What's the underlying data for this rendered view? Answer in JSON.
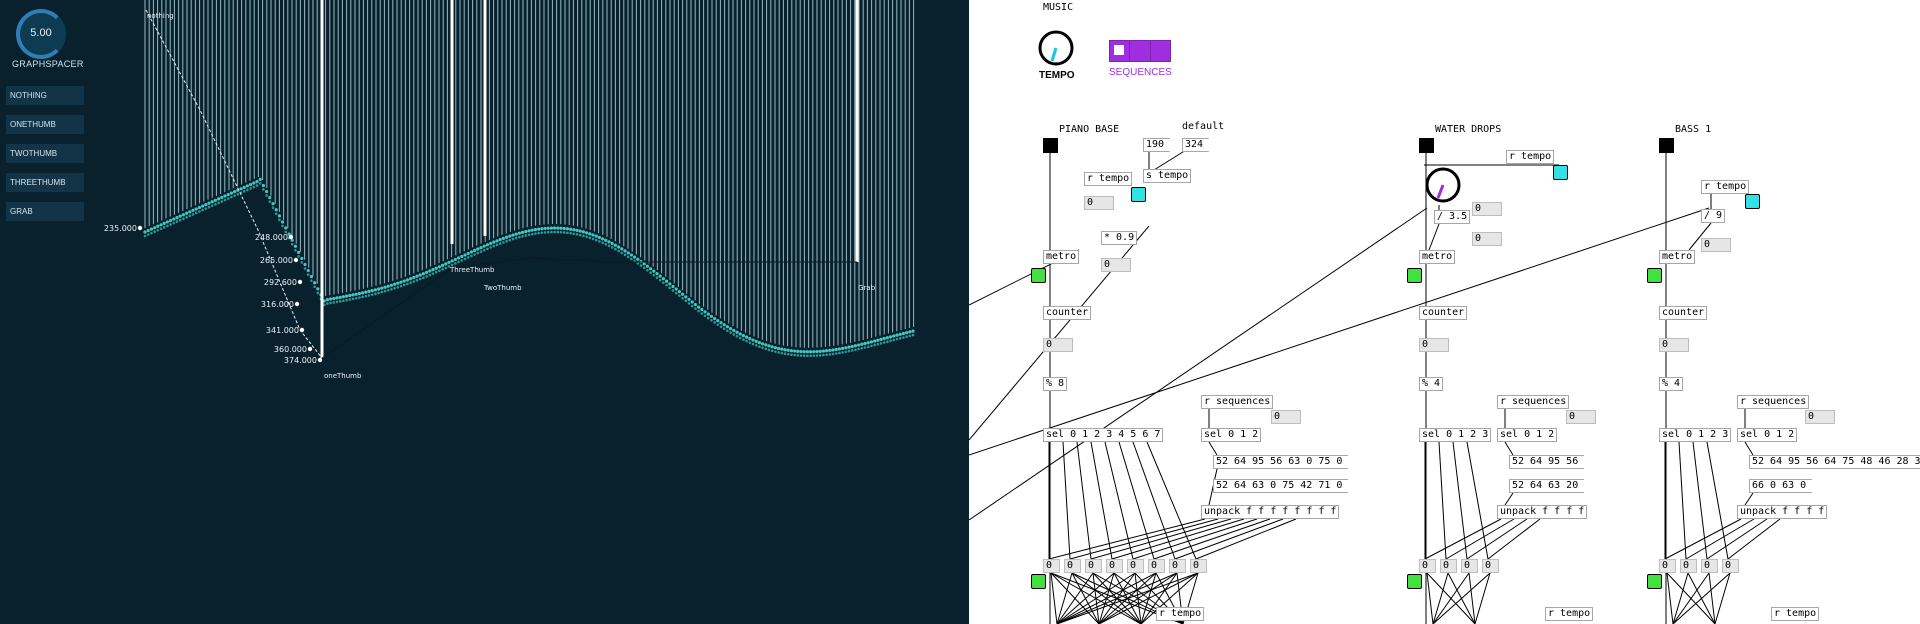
{
  "left": {
    "knob_value": "5.00",
    "knob_label": "GRAPHSPACER",
    "buttons": [
      "NOTHING",
      "ONETHUMB",
      "TWOTHUMB",
      "THREETHUMB",
      "GRAB"
    ],
    "y_labels": [
      "235.000",
      "248.000",
      "265.000",
      "292.600",
      "316.000",
      "341.000",
      "360.000",
      "374.000"
    ],
    "markers": [
      "nothing",
      "ThreeThumb",
      "TwoThumb",
      "oneThumb",
      "Grab"
    ],
    "colors": {
      "background": "#08212d",
      "points": "#3fc9c2",
      "button": "#133447"
    }
  },
  "pd": {
    "music_title": "MUSIC",
    "tempo_label": "TEMPO",
    "sequences_label": "SEQUENCES",
    "colors": {
      "tempo_needle": "#19c6d6",
      "sequences": "#a02ee0",
      "bang_green": "#44e040",
      "bang_cyan": "#33e0e6"
    },
    "piano": {
      "title": "PIANO BASE",
      "default_label": "default",
      "msg_190": "190",
      "msg_324": "324",
      "r_tempo": "r tempo",
      "s_tempo": "s tempo",
      "mult": "* 0.9",
      "metro": "metro",
      "counter": "counter",
      "mod": "% 8",
      "sel": "sel 0 1 2 3 4 5 6 7",
      "r_sequences": "r sequences",
      "sel2": "sel 0 1 2",
      "msg_a": "52 64 95 56 63 0 75 0",
      "msg_b": "52 64 63 0 75 42 71 0",
      "unpack": "unpack f f f f f f f f",
      "r_tempo_bottom": "r tempo",
      "zeros": [
        "0",
        "0",
        "0",
        "0",
        "0",
        "0",
        "0",
        "0"
      ],
      "num_zero": "0"
    },
    "water": {
      "title": "WATER DROPS",
      "r_tempo": "r tempo",
      "div": "/ 3.5",
      "metro": "metro",
      "counter": "counter",
      "mod": "% 4",
      "sel": "sel 0 1 2 3",
      "r_sequences": "r sequences",
      "sel2": "sel 0 1 2",
      "msg_a": "52 64 95 56",
      "msg_b": "52 64 63 20",
      "unpack": "unpack f f f f",
      "r_tempo_bottom": "r tempo",
      "zeros": [
        "0",
        "0",
        "0",
        "0"
      ],
      "num_zero": "0"
    },
    "bass": {
      "title": "BASS 1",
      "r_tempo": "r tempo",
      "div": "/ 9",
      "metro": "metro",
      "counter": "counter",
      "mod": "% 4",
      "sel": "sel 0 1 2 3",
      "r_sequences": "r sequences",
      "sel2": "sel 0 1 2",
      "msg_a": "52 64 95 56 64 75 48 46 28 3",
      "msg_b": "66 0 63 0",
      "unpack": "unpack f f f f",
      "r_tempo_bottom": "r tempo",
      "zeros": [
        "0",
        "0",
        "0",
        "0"
      ],
      "num_zero": "0"
    }
  }
}
